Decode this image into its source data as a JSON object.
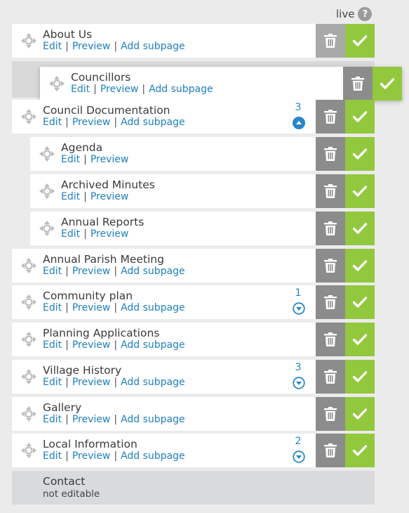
{
  "header": {
    "live_label": "live",
    "help_icon": "?"
  },
  "rows": [
    {
      "title": "About Us",
      "edit": "Edit",
      "preview": "Preview",
      "add": "Add subpage",
      "count": "",
      "toggle": ""
    },
    {
      "title": "Councillors",
      "edit": "Edit",
      "preview": "Preview",
      "add": "Add subpage",
      "count": "",
      "toggle": ""
    },
    {
      "title": "Council Documentation",
      "edit": "Edit",
      "preview": "Preview",
      "add": "Add subpage",
      "count": "3",
      "toggle": "collapse"
    },
    {
      "title": "Agenda",
      "edit": "Edit",
      "preview": "Preview",
      "add": "",
      "count": "",
      "toggle": ""
    },
    {
      "title": "Archived Minutes",
      "edit": "Edit",
      "preview": "Preview",
      "add": "",
      "count": "",
      "toggle": ""
    },
    {
      "title": "Annual Reports",
      "edit": "Edit",
      "preview": "Preview",
      "add": "",
      "count": "",
      "toggle": ""
    },
    {
      "title": "Annual Parish Meeting",
      "edit": "Edit",
      "preview": "Preview",
      "add": "Add subpage",
      "count": "",
      "toggle": ""
    },
    {
      "title": "Community plan",
      "edit": "Edit",
      "preview": "Preview",
      "add": "Add subpage",
      "count": "1",
      "toggle": "expand"
    },
    {
      "title": "Planning Applications",
      "edit": "Edit",
      "preview": "Preview",
      "add": "Add subpage",
      "count": "",
      "toggle": ""
    },
    {
      "title": "Village History",
      "edit": "Edit",
      "preview": "Preview",
      "add": "Add subpage",
      "count": "3",
      "toggle": "expand"
    },
    {
      "title": "Gallery",
      "edit": "Edit",
      "preview": "Preview",
      "add": "Add subpage",
      "count": "",
      "toggle": ""
    },
    {
      "title": "Local Information",
      "edit": "Edit",
      "preview": "Preview",
      "add": "Add subpage",
      "count": "2",
      "toggle": "expand"
    }
  ],
  "locked_row": {
    "title": "Contact",
    "note": "not editable"
  },
  "colors": {
    "link": "#1f7fc0",
    "live_green": "#92c83e",
    "delete_gray": "#8c8c8c",
    "count_blue": "#2a87c8"
  },
  "icons": {
    "drag": "drag-handle-icon",
    "delete": "trash-icon",
    "live": "checkmark-icon",
    "expand": "chevron-down-circle-icon",
    "collapse": "chevron-up-circle-icon"
  }
}
